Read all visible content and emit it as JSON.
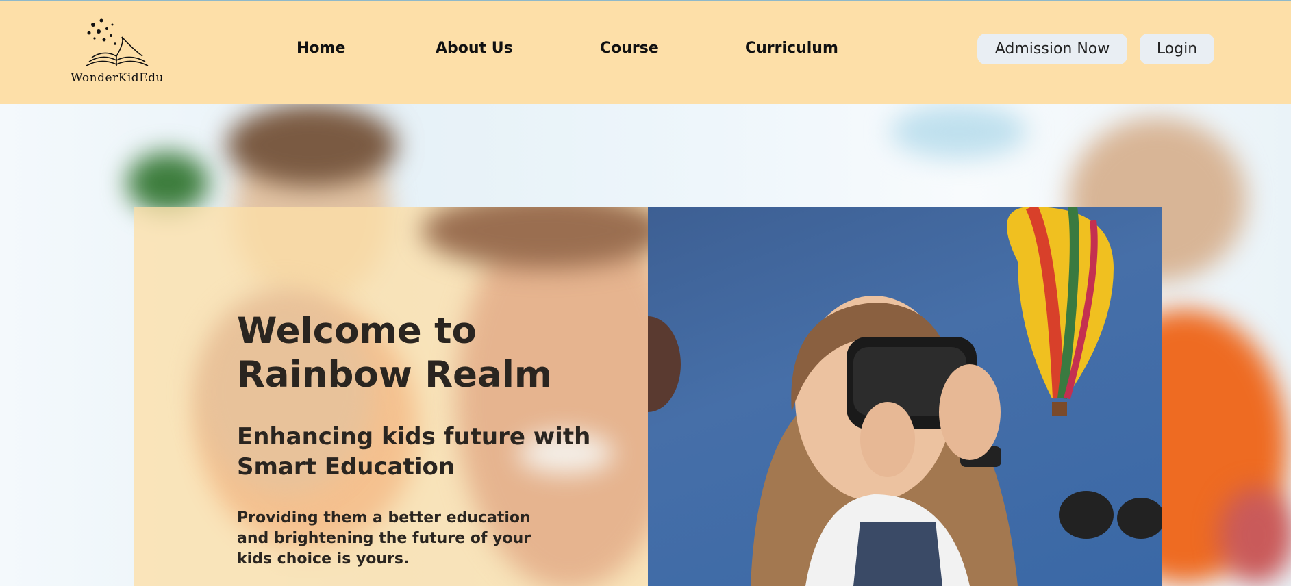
{
  "brand": {
    "name": "WonderKidEdu",
    "logo_icon": "open-book-sparkles-icon"
  },
  "nav": {
    "links": [
      "Home",
      "About Us",
      "Course",
      "Curriculum"
    ],
    "admission_label": "Admission Now",
    "login_label": "Login"
  },
  "hero": {
    "title": "Welcome to Rainbow Realm",
    "subtitle": "Enhancing kids future with Smart Education",
    "description": "Providing them a better education and brightening the future of your kids choice is yours."
  },
  "colors": {
    "navbar_bg": "#fddfa8",
    "pill_bg": "#e9eef3",
    "panel_tint": "#fddfa8",
    "text_dark": "#2a2520"
  }
}
